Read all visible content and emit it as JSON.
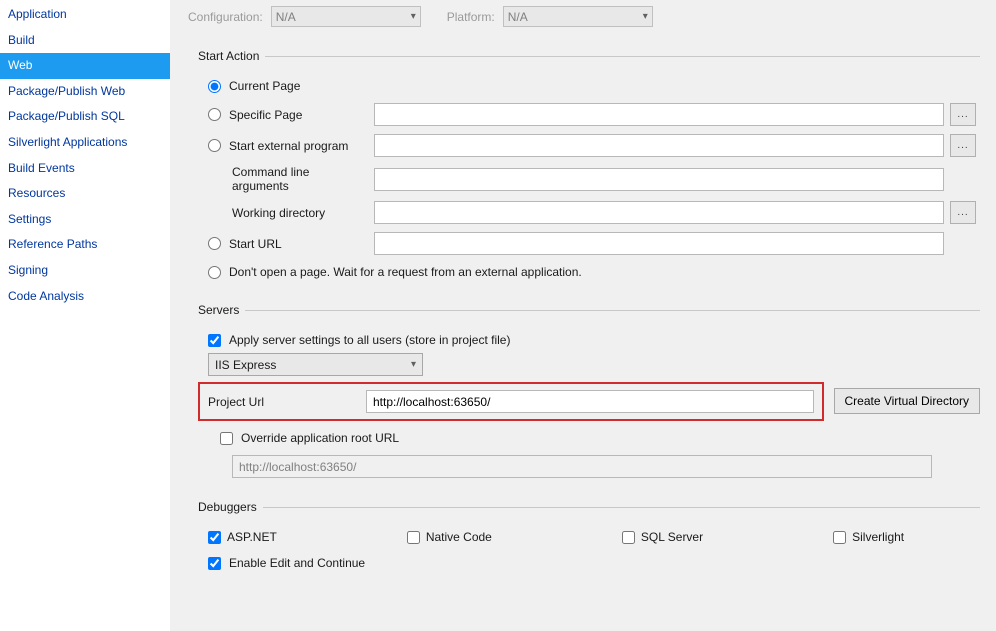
{
  "sidebar": {
    "items": [
      {
        "label": "Application"
      },
      {
        "label": "Build"
      },
      {
        "label": "Web"
      },
      {
        "label": "Package/Publish Web"
      },
      {
        "label": "Package/Publish SQL"
      },
      {
        "label": "Silverlight Applications"
      },
      {
        "label": "Build Events"
      },
      {
        "label": "Resources"
      },
      {
        "label": "Settings"
      },
      {
        "label": "Reference Paths"
      },
      {
        "label": "Signing"
      },
      {
        "label": "Code Analysis"
      }
    ],
    "selected_index": 2
  },
  "top": {
    "configuration_label": "Configuration:",
    "configuration_value": "N/A",
    "platform_label": "Platform:",
    "platform_value": "N/A"
  },
  "start_action": {
    "legend": "Start Action",
    "current_page": "Current Page",
    "specific_page": "Specific Page",
    "start_external_program": "Start external program",
    "cmd_args_label": "Command line arguments",
    "working_dir_label": "Working directory",
    "start_url": "Start URL",
    "dont_open": "Don't open a page.  Wait for a request from an external application.",
    "browse": "..."
  },
  "servers": {
    "legend": "Servers",
    "apply_all_users": "Apply server settings to all users (store in project file)",
    "server_select": "IIS Express",
    "project_url_label": "Project Url",
    "project_url_value": "http://localhost:63650/",
    "create_vd": "Create Virtual Directory",
    "override_root": "Override application root URL",
    "override_root_value": "http://localhost:63650/"
  },
  "debuggers": {
    "legend": "Debuggers",
    "aspnet": "ASP.NET",
    "native": "Native Code",
    "sql": "SQL Server",
    "silverlight": "Silverlight",
    "enable_edit": "Enable Edit and Continue"
  }
}
